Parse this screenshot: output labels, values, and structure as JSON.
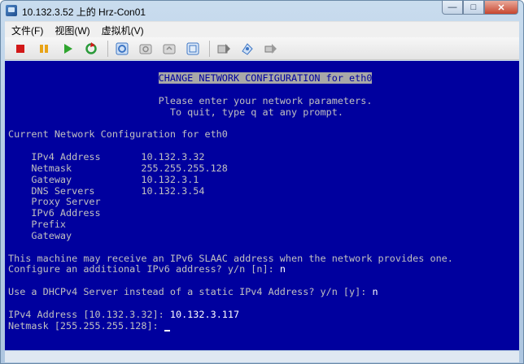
{
  "window": {
    "title": "10.132.3.52 上的 Hrz-Con01"
  },
  "menu": [
    {
      "label": "文件(F)"
    },
    {
      "label": "视图(W)"
    },
    {
      "label": "虚拟机(V)"
    }
  ],
  "toolbar": {
    "buttons": [
      {
        "icon": "stop-icon",
        "color": "#d21818"
      },
      {
        "icon": "pause-icon",
        "color": "#e8a317"
      },
      {
        "icon": "play-icon",
        "color": "#2fa52f"
      },
      {
        "icon": "reset-icon",
        "color": "#2a9a3a"
      },
      {
        "icon": "guest-settings-icon",
        "color": "#3b74c4"
      },
      {
        "icon": "snapshot-icon",
        "color": "#8a8a8a"
      },
      {
        "icon": "revert-snapshot-icon",
        "color": "#8a8a8a"
      },
      {
        "icon": "manage-snapshots-icon",
        "color": "#3b74c4"
      },
      {
        "icon": "send-ctrl-alt-del-icon",
        "color": "#8a8a8a"
      },
      {
        "icon": "connect-device-icon",
        "color": "#3b74c4"
      },
      {
        "icon": "disconnect-device-icon",
        "color": "#8a8a8a"
      }
    ]
  },
  "console": {
    "lines": [
      {
        "segments": [
          {
            "text": "                          "
          },
          {
            "text": "CHANGE NETWORK CONFIGURATION for eth0",
            "style": "hl"
          }
        ]
      },
      {
        "segments": [
          {
            "text": ""
          }
        ]
      },
      {
        "segments": [
          {
            "text": "                          Please enter your network parameters."
          }
        ]
      },
      {
        "segments": [
          {
            "text": "                            To quit, type q at any prompt."
          }
        ]
      },
      {
        "segments": [
          {
            "text": ""
          }
        ]
      },
      {
        "segments": [
          {
            "text": "Current Network Configuration for eth0"
          }
        ]
      },
      {
        "segments": [
          {
            "text": ""
          }
        ]
      },
      {
        "segments": [
          {
            "text": "    IPv4 Address       10.132.3.32"
          }
        ]
      },
      {
        "segments": [
          {
            "text": "    Netmask            255.255.255.128"
          }
        ]
      },
      {
        "segments": [
          {
            "text": "    Gateway            10.132.3.1"
          }
        ]
      },
      {
        "segments": [
          {
            "text": "    DNS Servers        10.132.3.54"
          }
        ]
      },
      {
        "segments": [
          {
            "text": "    Proxy Server"
          }
        ]
      },
      {
        "segments": [
          {
            "text": "    IPv6 Address"
          }
        ]
      },
      {
        "segments": [
          {
            "text": "    Prefix"
          }
        ]
      },
      {
        "segments": [
          {
            "text": "    Gateway"
          }
        ]
      },
      {
        "segments": [
          {
            "text": ""
          }
        ]
      },
      {
        "segments": [
          {
            "text": "This machine may receive an IPv6 SLAAC address when the network provides one."
          }
        ]
      },
      {
        "segments": [
          {
            "text": "Configure an additional IPv6 address? y/n [n]: "
          },
          {
            "text": "n",
            "style": "bright"
          }
        ]
      },
      {
        "segments": [
          {
            "text": ""
          }
        ]
      },
      {
        "segments": [
          {
            "text": "Use a DHCPv4 Server instead of a static IPv4 Address? y/n [y]: "
          },
          {
            "text": "n",
            "style": "bright"
          }
        ]
      },
      {
        "segments": [
          {
            "text": ""
          }
        ]
      },
      {
        "segments": [
          {
            "text": "IPv4 Address [10.132.3.32]: "
          },
          {
            "text": "10.132.3.117",
            "style": "bright"
          }
        ]
      },
      {
        "segments": [
          {
            "text": "Netmask [255.255.255.128]: "
          },
          {
            "text": "",
            "style": "cursor"
          }
        ]
      }
    ]
  }
}
